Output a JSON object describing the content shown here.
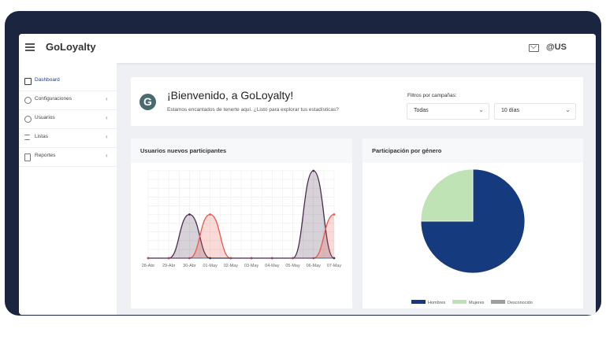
{
  "app": {
    "brand": "GoLoyalty",
    "user": "@US"
  },
  "icons": {
    "menu": "hamburger-menu-icon",
    "mail": "mail-icon"
  },
  "sidebar": {
    "items": [
      {
        "label": "Dashboard",
        "icon": "home-icon",
        "active": true
      },
      {
        "label": "Configuraciones",
        "icon": "gear-icon",
        "chevron": "‹"
      },
      {
        "label": "Usuarios",
        "icon": "users-icon",
        "chevron": "‹"
      },
      {
        "label": "Listas",
        "icon": "list-icon",
        "chevron": "‹"
      },
      {
        "label": "Reportes",
        "icon": "file-icon",
        "chevron": "‹"
      }
    ]
  },
  "welcome": {
    "title": "¡Bienvenido, a GoLoyalty!",
    "subtitle": "Estamos encantados de tenerte aquí. ¿Listo para explorar tus estadísticas?",
    "filter_label": "Filtros por campañas:",
    "campaign_select": "Todas",
    "days_select": "10 días"
  },
  "colors": {
    "accent": "#1e3a8a",
    "frame": "#1b2540",
    "background": "#eef0f4"
  },
  "cards": {
    "line_title": "Usuarios nuevos participantes",
    "pie_title": "Participación por género"
  },
  "chart_data": [
    {
      "type": "area",
      "title": "Usuarios nuevos participantes",
      "categories": [
        "28-Abr",
        "29-Abr",
        "30-Abr",
        "01-May",
        "02-May",
        "03-May",
        "04-May",
        "05-May",
        "06-May",
        "07-May"
      ],
      "series": [
        {
          "color": "#4a2c4f",
          "values": [
            0,
            0,
            1.0,
            0,
            0,
            0,
            0,
            0,
            2.0,
            0
          ]
        },
        {
          "color": "#e8584a",
          "values": [
            0,
            0,
            0,
            1.0,
            0,
            0,
            0,
            0,
            0,
            1.0
          ]
        }
      ],
      "ylim": [
        0,
        2
      ],
      "grid": true
    },
    {
      "type": "pie",
      "title": "Participación por género",
      "labels": [
        "Hombres",
        "Mujeres",
        "Desconocido"
      ],
      "values": [
        75,
        25,
        0
      ],
      "colors": [
        "#163a7e",
        "#bfe3b4",
        "#9e9e9e"
      ],
      "legend": "bottom"
    }
  ]
}
